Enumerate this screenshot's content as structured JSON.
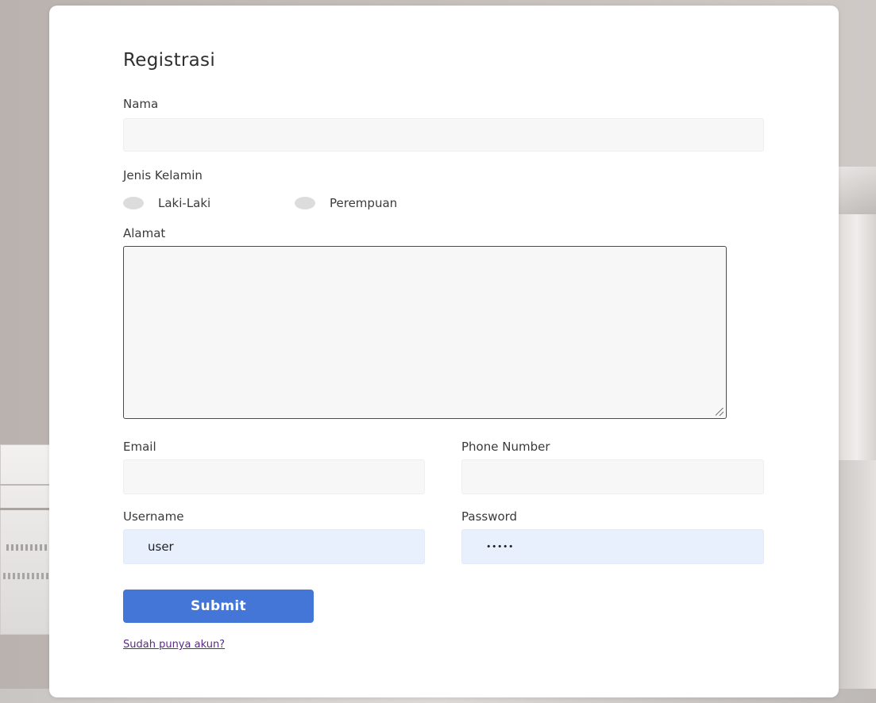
{
  "form": {
    "title": "Registrasi",
    "nama": {
      "label": "Nama",
      "value": ""
    },
    "gender": {
      "label": "Jenis Kelamin",
      "options": [
        {
          "label": "Laki-Laki",
          "selected": false
        },
        {
          "label": "Perempuan",
          "selected": false
        }
      ]
    },
    "alamat": {
      "label": "Alamat",
      "value": ""
    },
    "email": {
      "label": "Email",
      "value": ""
    },
    "phone": {
      "label": "Phone Number",
      "value": ""
    },
    "username": {
      "label": "Username",
      "value": "user"
    },
    "password": {
      "label": "Password",
      "masked_value": "•••••"
    },
    "submit_label": "Submit",
    "login_link": "Sudah punya akun?"
  },
  "colors": {
    "button": "#4476d8",
    "autofill": "#e8f0fe",
    "field": "#f7f7f7",
    "link": "#5a2a86"
  }
}
